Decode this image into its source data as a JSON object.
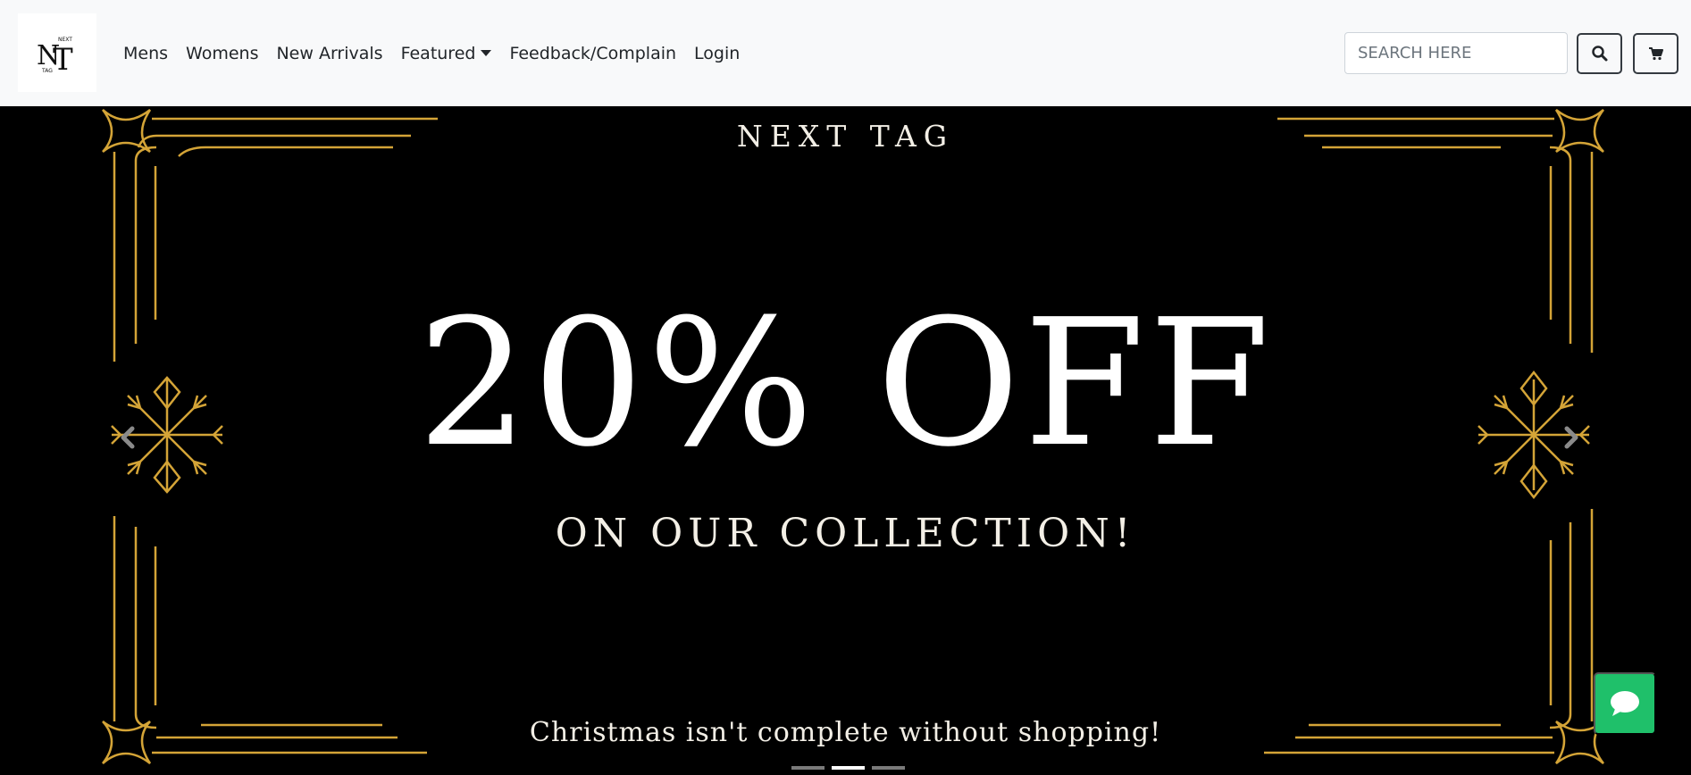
{
  "brand": {
    "logo_letters": "NT",
    "logo_word_top": "NEXT",
    "logo_word_bottom": "TAG"
  },
  "nav": {
    "items": [
      {
        "label": "Mens"
      },
      {
        "label": "Womens"
      },
      {
        "label": "New Arrivals"
      },
      {
        "label": "Featured",
        "has_dropdown": true
      },
      {
        "label": "Feedback/Complain"
      },
      {
        "label": "Login"
      }
    ]
  },
  "search": {
    "placeholder": "SEARCH HERE",
    "value": ""
  },
  "icons": {
    "search": "search-icon",
    "cart": "cart-icon",
    "prev": "chevron-left-icon",
    "next": "chevron-right-icon",
    "chat": "chat-bubble-icon"
  },
  "hero": {
    "brand": "NEXT TAG",
    "headline": "20% OFF",
    "subheadline": "ON OUR COLLECTION!",
    "tagline": "Christmas isn't complete without shopping!",
    "slide_count": 3,
    "active_slide": 2
  },
  "colors": {
    "gold": "#d4a437",
    "chat_green": "#1fc06a",
    "navbar_bg": "#f8f9fa"
  }
}
